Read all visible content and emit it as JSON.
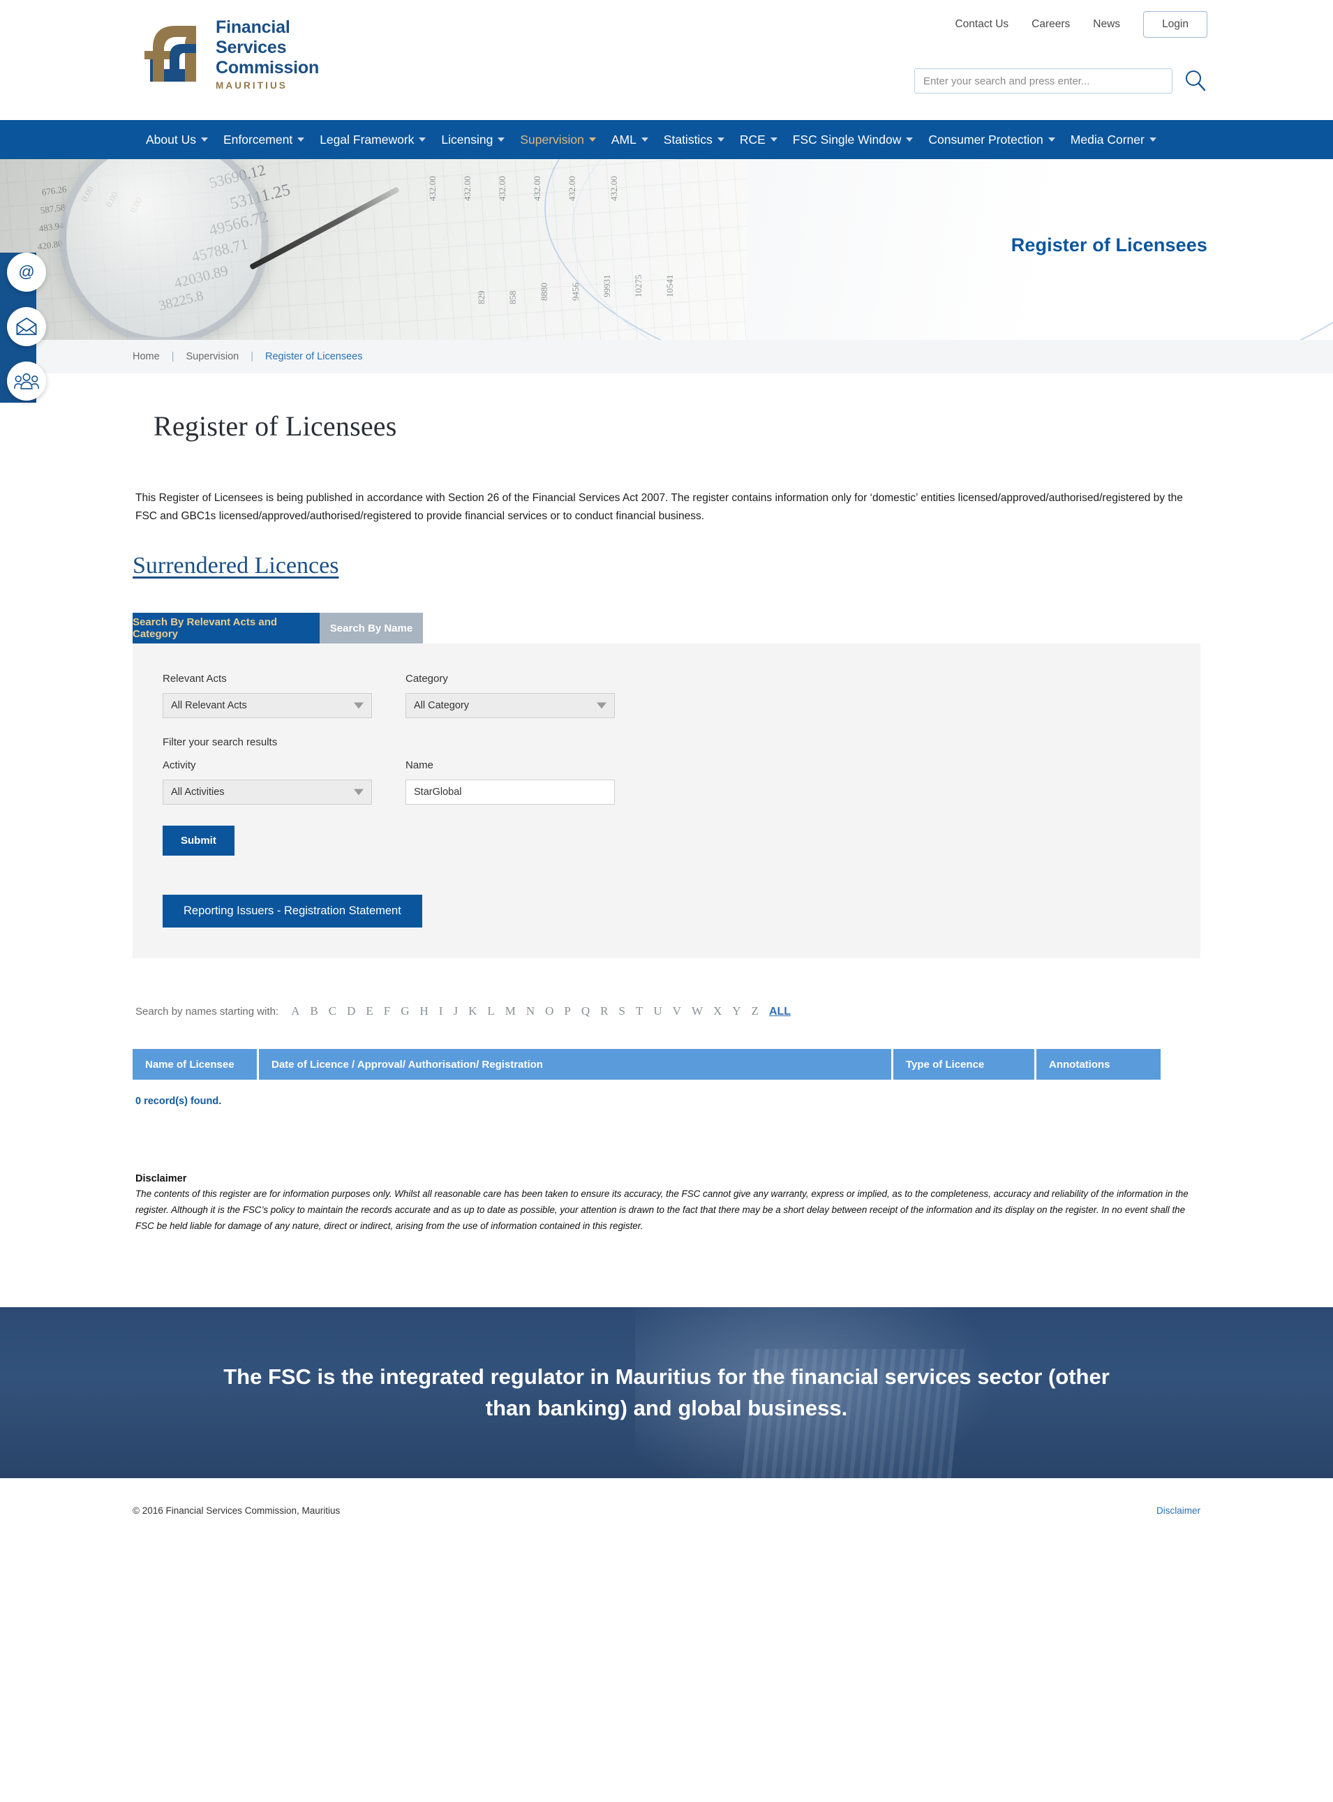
{
  "header": {
    "logo": {
      "line1": "Financial",
      "line2": "Services",
      "line3": "Commission",
      "sub": "MAURITIUS"
    },
    "top_links": [
      {
        "label": "Contact Us"
      },
      {
        "label": "Careers"
      },
      {
        "label": "News"
      }
    ],
    "login_label": "Login",
    "search": {
      "placeholder": "Enter your search and press enter...",
      "value": ""
    }
  },
  "nav": {
    "items": [
      {
        "label": "About Us",
        "active": false
      },
      {
        "label": "Enforcement",
        "active": false
      },
      {
        "label": "Legal Framework",
        "active": false
      },
      {
        "label": "Licensing",
        "active": false
      },
      {
        "label": "Supervision",
        "active": true
      },
      {
        "label": "AML",
        "active": false
      },
      {
        "label": "Statistics",
        "active": false
      },
      {
        "label": "RCE",
        "active": false
      },
      {
        "label": "FSC Single Window",
        "active": false
      },
      {
        "label": "Consumer Protection",
        "active": false
      },
      {
        "label": "Media Corner",
        "active": false
      }
    ]
  },
  "hero": {
    "title": "Register of Licensees"
  },
  "side_icons": [
    {
      "name": "at-sign-icon",
      "glyph": "@"
    },
    {
      "name": "envelope-icon",
      "glyph": "envelope"
    },
    {
      "name": "people-icon",
      "glyph": "people"
    }
  ],
  "breadcrumb": {
    "home": "Home",
    "sep1": "|",
    "section": "Supervision",
    "sep2": "|",
    "current": "Register of Licensees"
  },
  "page": {
    "title": "Register of Licensees",
    "intro": "This Register of Licensees is being published in accordance with Section 26 of the Financial Services Act 2007. The register contains information only for ‘domestic’ entities licensed/approved/authorised/registered by the FSC and GBC1s licensed/approved/authorised/registered to provide financial services or to conduct financial business.",
    "surrendered_link": "Surrendered Licences"
  },
  "search_panel": {
    "tabs": [
      {
        "label": "Search By Relevant Acts and Category",
        "active": true
      },
      {
        "label": "Search By Name",
        "active": false
      }
    ],
    "relevant_acts": {
      "label": "Relevant Acts",
      "value": "All Relevant Acts"
    },
    "category": {
      "label": "Category",
      "value": "All Category"
    },
    "filter_note": "Filter your search results",
    "activity": {
      "label": "Activity",
      "value": "All Activities"
    },
    "name": {
      "label": "Name",
      "value": "StarGlobal",
      "placeholder": ""
    },
    "submit_label": "Submit",
    "reporting_issuers_label": "Reporting Issuers - Registration Statement"
  },
  "alphabet": {
    "label": "Search by names starting with:",
    "letters": [
      "A",
      "B",
      "C",
      "D",
      "E",
      "F",
      "G",
      "H",
      "I",
      "J",
      "K",
      "L",
      "M",
      "N",
      "O",
      "P",
      "Q",
      "R",
      "S",
      "T",
      "U",
      "V",
      "W",
      "X",
      "Y",
      "Z"
    ],
    "all": "ALL"
  },
  "results": {
    "columns": [
      "Name of Licensee",
      "Date of Licence / Approval/ Authorisation/ Registration",
      "Type of Licence",
      "Annotations"
    ],
    "rows": [],
    "count_text": "0 record(s) found."
  },
  "disclaimer": {
    "heading": "Disclaimer",
    "body": "The contents of this register are for information purposes only. Whilst all reasonable care has been taken to ensure its accuracy, the FSC cannot give any warranty, express or implied, as to the completeness, accuracy and reliability of the information in the register. Although it is the FSC’s policy to maintain the records accurate and as up to date as possible, your attention is drawn to the fact that there may be a short delay between receipt of the information and its display on the register. In no event shall the FSC be held liable for damage of any nature, direct or indirect, arising from the use of information contained in this register."
  },
  "footer_banner": {
    "text": "The FSC is the integrated regulator in Mauritius for the financial services sector (other than banking) and global business."
  },
  "footer": {
    "copyright": "© 2016 Financial Services Commission, Mauritius",
    "disclaimer_link": "Disclaimer"
  },
  "colors": {
    "brand_blue": "#0b559c",
    "brand_gold": "#93784b",
    "nav_active": "#dcb97a",
    "table_header": "#5a9bdc",
    "link_blue": "#2c6fb0"
  }
}
